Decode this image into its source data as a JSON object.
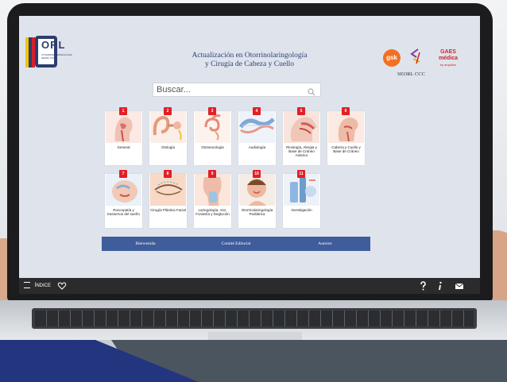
{
  "site": {
    "logo_text": "ORL",
    "logo_subtext": "OTORRINOLARINGOLOGÍA SEORL CCC",
    "title_line1": "Actualización en Otorrinolaringología",
    "title_line2": "y Cirugía de Cabeza y Cuello",
    "sponsors": {
      "gsk": "gsk",
      "gaes_line1": "GAES",
      "gaes_line2": "médica",
      "gaes_small": "by amplifon",
      "seorl_label": "SEORL CCC"
    }
  },
  "search": {
    "placeholder": "Buscar..."
  },
  "tiles": [
    {
      "number": "1",
      "label": "General"
    },
    {
      "number": "2",
      "label": "Otología"
    },
    {
      "number": "3",
      "label": "Otoneurología"
    },
    {
      "number": "4",
      "label": "Audiología"
    },
    {
      "number": "5",
      "label": "Rinología, Alergia y Base de Cráneo Anterior"
    },
    {
      "number": "6",
      "label": "Cabeza y Cuello y Base de Cráneo"
    },
    {
      "number": "7",
      "label": "Roncopatía y trastornos del sueño"
    },
    {
      "number": "8",
      "label": "Cirugía Plástica Facial"
    },
    {
      "number": "9",
      "label": "Laringología, Voz, Foniatría y Deglución"
    },
    {
      "number": "10",
      "label": "Otorrinolaringología Pediátrica"
    },
    {
      "number": "11",
      "label": "Investigación"
    }
  ],
  "nav": {
    "welcome": "Bienvenida",
    "committee": "Comité Editorial",
    "authors": "Autores"
  },
  "bottombar": {
    "index_label": "ÍNDICE"
  },
  "colors": {
    "accent": "#3f5c9b",
    "badge": "#e21f26",
    "title": "#2a3f7a"
  }
}
